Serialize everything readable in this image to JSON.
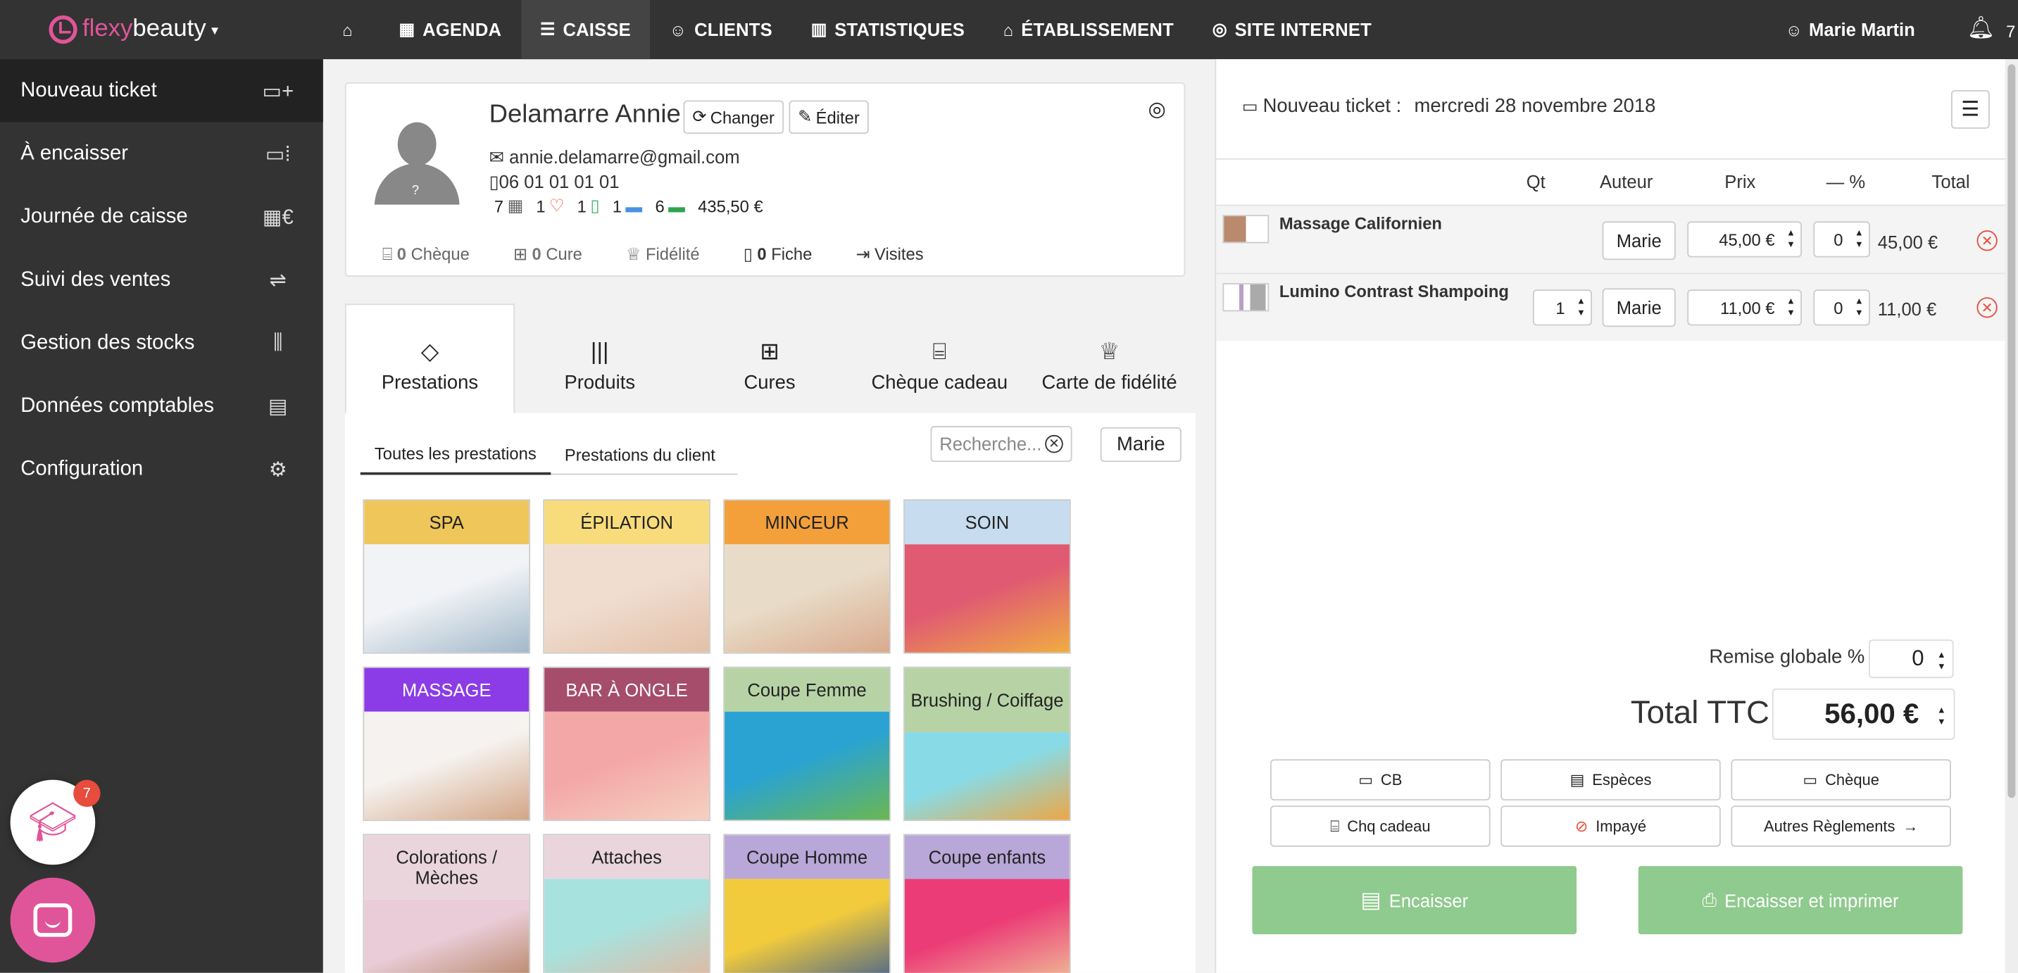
{
  "brand": {
    "name_a": "flexy",
    "name_b": "beauty"
  },
  "nav": [
    {
      "label": "",
      "icon": "home-icon",
      "glyph": "⌂"
    },
    {
      "label": "AGENDA",
      "icon": "calendar-icon",
      "glyph": "▦"
    },
    {
      "label": "CAISSE",
      "icon": "cash-register-icon",
      "glyph": "☰"
    },
    {
      "label": "CLIENTS",
      "icon": "users-icon",
      "glyph": "☺"
    },
    {
      "label": "STATISTIQUES",
      "icon": "chart-icon",
      "glyph": "▥"
    },
    {
      "label": "ÉTABLISSEMENT",
      "icon": "store-icon",
      "glyph": "⌂"
    },
    {
      "label": "SITE INTERNET",
      "icon": "globe-icon",
      "glyph": "◎"
    }
  ],
  "user": {
    "name": "Marie Martin",
    "notifications": "7"
  },
  "sidebar": [
    {
      "label": "Nouveau ticket",
      "glyph": "▭+"
    },
    {
      "label": "À encaisser",
      "glyph": "▭⁞"
    },
    {
      "label": "Journée de caisse",
      "glyph": "▦€"
    },
    {
      "label": "Suivi des ventes",
      "glyph": "⇌"
    },
    {
      "label": "Gestion des stocks",
      "glyph": "⫼"
    },
    {
      "label": "Données comptables",
      "glyph": "▤"
    },
    {
      "label": "Configuration",
      "glyph": "⚙"
    }
  ],
  "badges": {
    "academy": "7"
  },
  "client": {
    "name": "Delamarre Annie",
    "change_label": "Changer",
    "edit_label": "Éditer",
    "email": "annie.delamarre@gmail.com",
    "phone": "06 01 01 01 01",
    "stats": {
      "s1": "7",
      "s2": "1",
      "s3": "1",
      "s4": "1",
      "s5": "6",
      "amount": "435,50 €"
    },
    "footer": {
      "cheque_count": "0",
      "cheque": "Chèque",
      "cure_count": "0",
      "cure": "Cure",
      "fidelite": "Fidélité",
      "fiche_count": "0",
      "fiche": "Fiche",
      "visites": "Visites"
    }
  },
  "tabs": [
    {
      "label": "Prestations",
      "glyph": "◇"
    },
    {
      "label": "Produits",
      "glyph": "|||"
    },
    {
      "label": "Cures",
      "glyph": "⊞"
    },
    {
      "label": "Chèque cadeau",
      "glyph": "⌸"
    },
    {
      "label": "Carte de fidélité",
      "glyph": "♕"
    }
  ],
  "subtabs": [
    "Toutes les prestations",
    "Prestations du client"
  ],
  "search": {
    "placeholder": "Recherche..."
  },
  "staff_filter": "Marie",
  "categories": [
    {
      "label": "SPA",
      "color": "#efc65a",
      "img": [
        "#f1f3f6",
        "#9fb6c8"
      ]
    },
    {
      "label": "ÉPILATION",
      "color": "#f8dc7c",
      "img": [
        "#f0ddd0",
        "#e2bfa6"
      ]
    },
    {
      "label": "MINCEUR",
      "color": "#f3a03b",
      "img": [
        "#e8dcc8",
        "#d9a88b"
      ]
    },
    {
      "label": "SOIN",
      "color": "#c7dcee",
      "img": [
        "#e05a72",
        "#f0b040"
      ]
    },
    {
      "label": "MASSAGE",
      "color": "#8b3ce6",
      "img": [
        "#f5f2ef",
        "#d2a282"
      ]
    },
    {
      "label": "BAR À ONGLE",
      "color": "#a54d6b",
      "img": [
        "#f4a7a7",
        "#f5d3c2"
      ]
    },
    {
      "label": "Coupe Femme",
      "color": "#b7d3a6",
      "img": [
        "#2aa3d2",
        "#6db84c"
      ]
    },
    {
      "label": "Brushing / Coiffage",
      "color": "#b7d3a6",
      "img": [
        "#88dbe6",
        "#f0a540"
      ]
    },
    {
      "label": "Colorations / Mèches",
      "color": "#ead5dc",
      "img": [
        "#e9ccd7",
        "#b17d5a"
      ]
    },
    {
      "label": "Attaches",
      "color": "#ead5dc",
      "img": [
        "#a8e2de",
        "#e9b39a"
      ]
    },
    {
      "label": "Coupe Homme",
      "color": "#b8a7d8",
      "img": [
        "#f2cb3c",
        "#3a5b93"
      ]
    },
    {
      "label": "Coupe enfants",
      "color": "#b8a7d8",
      "img": [
        "#ec3c77",
        "#f0c89a"
      ]
    }
  ],
  "ticket": {
    "title": "Nouveau ticket :",
    "date": "mercredi 28 novembre 2018",
    "columns": {
      "qt": "Qt",
      "auteur": "Auteur",
      "prix": "Prix",
      "discount": "— %",
      "total": "Total"
    },
    "lines": [
      {
        "name": "Massage Californien",
        "qty": "",
        "auteur": "Marie",
        "prix": "45,00 €",
        "discount": "0",
        "total": "45,00 €"
      },
      {
        "name": "Lumino Contrast Shampoing",
        "qty": "1",
        "auteur": "Marie",
        "prix": "11,00 €",
        "discount": "0",
        "total": "11,00 €"
      }
    ],
    "remise_label": "Remise globale %",
    "remise_value": "0",
    "total_label": "Total TTC",
    "total_value": "56,00 €",
    "payments": [
      "CB",
      "Espèces",
      "Chèque",
      "Chq cadeau",
      "Impayé",
      "Autres Règlements"
    ],
    "encaisser": "Encaisser",
    "encaisser_imprimer": "Encaisser et imprimer"
  }
}
